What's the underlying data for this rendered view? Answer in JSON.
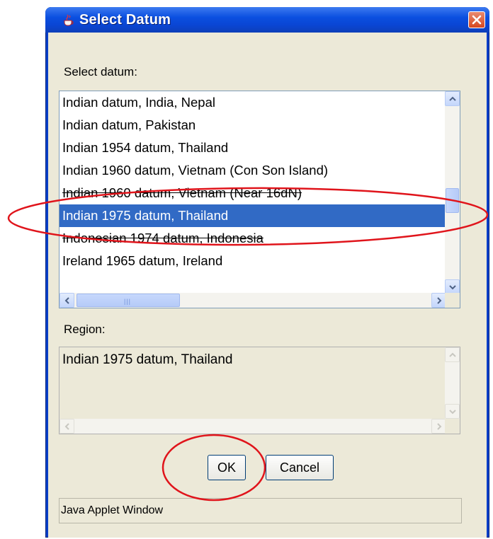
{
  "window": {
    "title": "Select Datum"
  },
  "labels": {
    "select_datum": "Select datum:",
    "region": "Region:"
  },
  "list": {
    "items": [
      "Indian datum, India, Nepal",
      "Indian datum, Pakistan",
      "Indian 1954 datum, Thailand",
      "Indian 1960 datum, Vietnam (Con Son Island)",
      "Indian 1960 datum, Vietnam (Near 16dN)",
      "Indian 1975 datum, Thailand",
      "Indonesian 1974 datum, Indonesia",
      "Ireland 1965 datum, Ireland"
    ],
    "selected_index": 5,
    "vertical_scroll_fraction": 0.55,
    "horizontal_scroll_fraction": 0.0
  },
  "region": {
    "text": "Indian 1975 datum, Thailand"
  },
  "buttons": {
    "ok": "OK",
    "cancel": "Cancel"
  },
  "status": {
    "text": "Java Applet Window"
  },
  "colors": {
    "title_bar": "#0a46d4",
    "selection": "#316ac5",
    "dialog_bg": "#ece9d8",
    "annotation": "#e0141b"
  },
  "icons": {
    "title": "java-cup-icon",
    "close": "close-icon",
    "scroll_up": "chevron-up-icon",
    "scroll_down": "chevron-down-icon",
    "scroll_left": "chevron-left-icon",
    "scroll_right": "chevron-right-icon"
  }
}
